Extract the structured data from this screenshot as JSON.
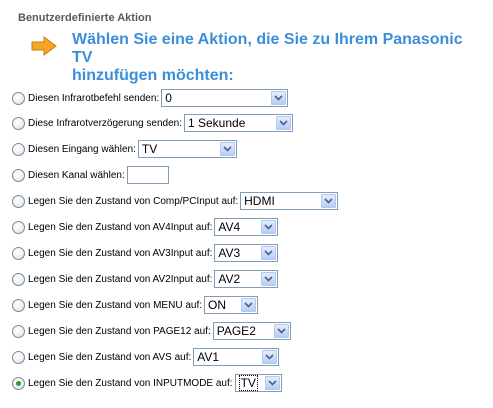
{
  "section_title": "Benutzerdefinierte Aktion",
  "heading_line1": "Wählen Sie eine Aktion, die Sie zu Ihrem Panasonic TV",
  "heading_line2": "hinzufügen möchten:",
  "arrow_icon": "right-arrow-icon",
  "colors": {
    "heading": "#3b8fd9",
    "arrow": "#f5a623",
    "select_border": "#7f9db9",
    "radio_selected": "#2f9a2f"
  },
  "rows": [
    {
      "label": "Diesen Infrarotbefehl senden:",
      "value": "0",
      "selected": false
    },
    {
      "label": "Diese Infrarotverzögerung senden:",
      "value": "1 Sekunde",
      "selected": false
    },
    {
      "label": "Diesen Eingang wählen:",
      "value": "TV",
      "selected": false
    },
    {
      "label": "Diesen Kanal wählen:",
      "value": "",
      "selected": false
    },
    {
      "label": "Legen Sie den Zustand von Comp/PCInput auf:",
      "value": "HDMI",
      "selected": false
    },
    {
      "label": "Legen Sie den Zustand von AV4Input auf:",
      "value": "AV4",
      "selected": false
    },
    {
      "label": "Legen Sie den Zustand von AV3Input auf:",
      "value": "AV3",
      "selected": false
    },
    {
      "label": "Legen Sie den Zustand von AV2Input auf:",
      "value": "AV2",
      "selected": false
    },
    {
      "label": "Legen Sie den Zustand von MENU auf:",
      "value": "ON",
      "selected": false
    },
    {
      "label": "Legen Sie den Zustand von PAGE12 auf:",
      "value": "PAGE2",
      "selected": false
    },
    {
      "label": "Legen Sie den Zustand von AVS auf:",
      "value": "AV1",
      "selected": false
    },
    {
      "label": "Legen Sie den Zustand von INPUTMODE auf:",
      "value": "TV",
      "selected": true
    }
  ]
}
